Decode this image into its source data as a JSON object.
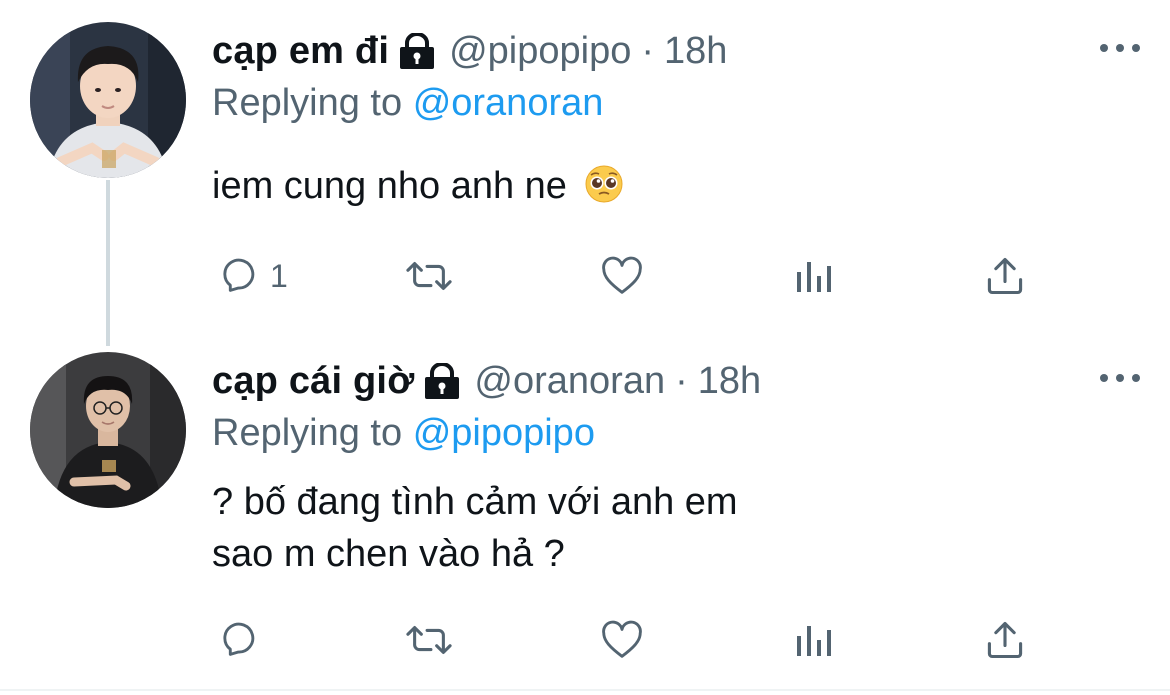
{
  "tweets": [
    {
      "display_name": "cạp em đi",
      "handle": "@pipopipo",
      "separator": "·",
      "time": "18h",
      "replying_prefix": "Replying to",
      "replying_to": "@oranoran",
      "text_lines": [
        "iem cung nho anh ne"
      ],
      "emoji": "pleading-face",
      "reply_count": "1",
      "locked": true
    },
    {
      "display_name": "cạp cái giờ",
      "handle": "@oranoran",
      "separator": "·",
      "time": "18h",
      "replying_prefix": "Replying to",
      "replying_to": "@pipopipo",
      "text_lines": [
        "? bố đang tình cảm với anh em",
        "sao m chen vào hả ?"
      ],
      "reply_count": "",
      "locked": true
    }
  ],
  "colors": {
    "text_primary": "#0f1419",
    "text_secondary": "#536471",
    "link": "#1d9bf0",
    "thread_line": "#cfd9de"
  },
  "icons": {
    "lock": "lock-icon",
    "more": "more-horizontal-icon",
    "reply": "reply-icon",
    "retweet": "retweet-icon",
    "like": "heart-icon",
    "stats": "analytics-icon",
    "share": "share-icon"
  }
}
